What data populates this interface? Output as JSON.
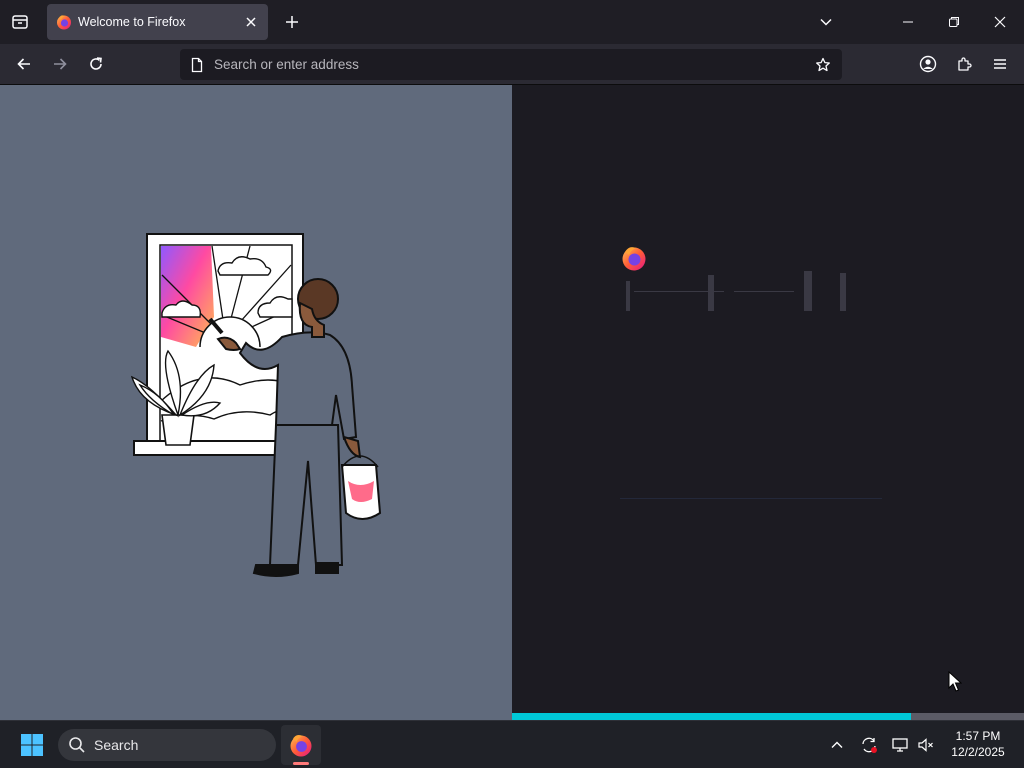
{
  "browser": {
    "tab": {
      "title": "Welcome to Firefox"
    },
    "urlbar": {
      "placeholder": "Search or enter address"
    }
  },
  "page": {
    "loading_progress_percent": 78,
    "colors": {
      "left_pane": "#606a7c",
      "right_pane": "#1c1b22",
      "progress": "#00c8d7"
    }
  },
  "taskbar": {
    "search_label": "Search",
    "clock": {
      "time": "1:57 PM",
      "date": "12/2/2025"
    }
  },
  "icons": [
    "tab-overview-icon",
    "firefox-icon",
    "close-icon",
    "plus-icon",
    "chevron-down-icon",
    "minimize-icon",
    "restore-icon",
    "back-icon",
    "forward-icon",
    "reload-icon",
    "page-icon",
    "star-icon",
    "account-icon",
    "extensions-icon",
    "menu-icon",
    "windows-start-icon",
    "search-icon",
    "chevron-up-icon",
    "sync-icon",
    "display-icon",
    "volume-muted-icon",
    "mouse-pointer-icon"
  ]
}
